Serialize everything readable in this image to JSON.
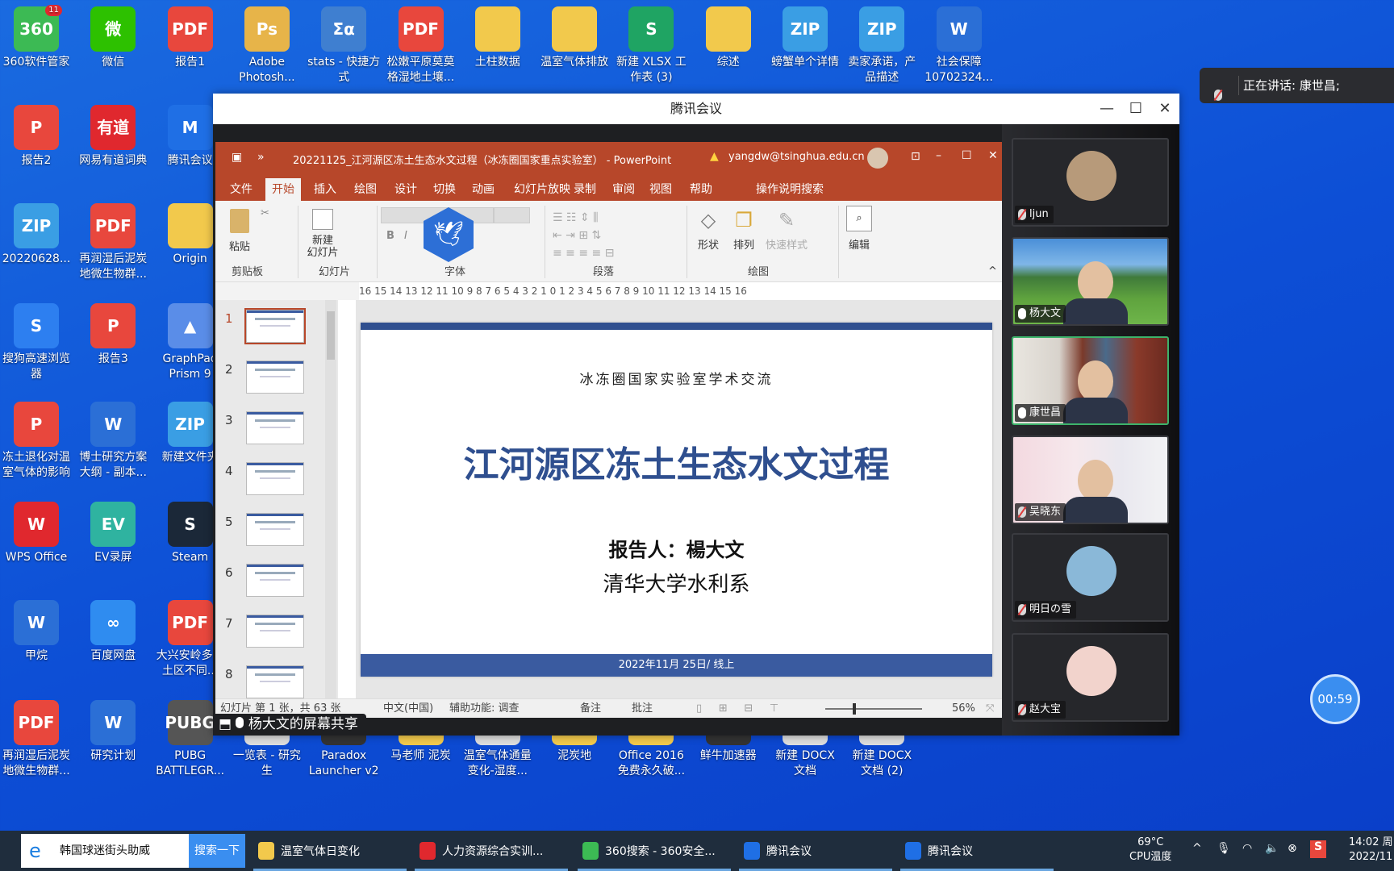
{
  "desktop_icons": [
    {
      "label": "360软件管家",
      "glyph": "360",
      "color": "#3cba54",
      "badge": "11"
    },
    {
      "label": "微信",
      "glyph": "微",
      "color": "#2dc100"
    },
    {
      "label": "报告1",
      "glyph": "PDF",
      "color": "#e8473d"
    },
    {
      "label": "Adobe Photosh...",
      "glyph": "Ps",
      "color": "#e7b449"
    },
    {
      "label": "stats - 快捷方式",
      "glyph": "Σα",
      "color": "#3f7fd0"
    },
    {
      "label": "松嫩平原莫莫格湿地土壤...",
      "glyph": "PDF",
      "color": "#e8473d"
    },
    {
      "label": "土柱数据",
      "glyph": "",
      "color": "#f2c94c"
    },
    {
      "label": "温室气体排放",
      "glyph": "",
      "color": "#f2c94c"
    },
    {
      "label": "新建 XLSX 工作表 (3)",
      "glyph": "S",
      "color": "#1fa463"
    },
    {
      "label": "综述",
      "glyph": "",
      "color": "#f2c94c"
    },
    {
      "label": "螃蟹单个详情",
      "glyph": "ZIP",
      "color": "#3a9ee4"
    },
    {
      "label": "卖家承诺，产品描述",
      "glyph": "ZIP",
      "color": "#3a9ee4"
    },
    {
      "label": "社会保障10702324...",
      "glyph": "W",
      "color": "#2b6fd6"
    },
    {
      "label": "报告2",
      "glyph": "P",
      "color": "#e8473d"
    },
    {
      "label": "网易有道词典",
      "glyph": "有道",
      "color": "#e0282e"
    },
    {
      "label": "腾讯会议",
      "glyph": "M",
      "color": "#1f6fe5"
    },
    {
      "label": "20220628...",
      "glyph": "ZIP",
      "color": "#3a9ee4"
    },
    {
      "label": "再润湿后泥炭地微生物群...",
      "glyph": "PDF",
      "color": "#e8473d"
    },
    {
      "label": "Origin",
      "glyph": "",
      "color": "#f2c94c"
    },
    {
      "label": "搜狗高速浏览器",
      "glyph": "S",
      "color": "#2d7ff0"
    },
    {
      "label": "报告3",
      "glyph": "P",
      "color": "#e8473d"
    },
    {
      "label": "GraphPad Prism 9",
      "glyph": "▲",
      "color": "#5a8de8"
    },
    {
      "label": "冻土退化对温室气体的影响",
      "glyph": "P",
      "color": "#e8473d"
    },
    {
      "label": "博士研究方案大纲 - 副本...",
      "glyph": "W",
      "color": "#2b6fd6"
    },
    {
      "label": "新建文件夹",
      "glyph": "ZIP",
      "color": "#3a9ee4"
    },
    {
      "label": "WPS Office",
      "glyph": "W",
      "color": "#e0282e"
    },
    {
      "label": "EV录屏",
      "glyph": "EV",
      "color": "#2fb3a0"
    },
    {
      "label": "Steam",
      "glyph": "S",
      "color": "#1b2838"
    },
    {
      "label": "甲烷",
      "glyph": "W",
      "color": "#2b6fd6"
    },
    {
      "label": "百度网盘",
      "glyph": "∞",
      "color": "#2f8cf0"
    },
    {
      "label": "大兴安岭多冻土区不同...",
      "glyph": "PDF",
      "color": "#e8473d"
    },
    {
      "label": "再润湿后泥炭地微生物群...",
      "glyph": "PDF",
      "color": "#e8473d"
    },
    {
      "label": "研究计划",
      "glyph": "W",
      "color": "#2b6fd6"
    },
    {
      "label": "PUBG BATTLEGR...",
      "glyph": "PUBG",
      "color": "#555"
    },
    {
      "label": "一览表 - 研究生",
      "glyph": "",
      "color": "#ddd"
    },
    {
      "label": "Paradox Launcher v2",
      "glyph": "",
      "color": "#333"
    },
    {
      "label": "马老师 泥炭",
      "glyph": "",
      "color": "#f2c94c"
    },
    {
      "label": "温室气体通量变化-湿度...",
      "glyph": "",
      "color": "#ddd"
    },
    {
      "label": "泥炭地",
      "glyph": "",
      "color": "#f2c94c"
    },
    {
      "label": "Office 2016 免费永久破...",
      "glyph": "",
      "color": "#f2c94c"
    },
    {
      "label": "鲜牛加速器",
      "glyph": "",
      "color": "#333"
    },
    {
      "label": "新建 DOCX 文档",
      "glyph": "",
      "color": "#ddd"
    },
    {
      "label": "新建 DOCX 文档 (2)",
      "glyph": "",
      "color": "#ddd"
    }
  ],
  "notification": {
    "text": "正在讲话: 康世昌;"
  },
  "meeting": {
    "title": "腾讯会议",
    "share_label": "杨大文的屏幕共享",
    "timer": "00:59",
    "participants": [
      {
        "name": "ljun",
        "muted": true,
        "speaking": false,
        "kind": "avatar",
        "avatar_color": "#b79a7a"
      },
      {
        "name": "杨大文",
        "muted": false,
        "speaking": false,
        "kind": "video",
        "bg": "linear-gradient(#4a8fd8 0%,#7fb6e8 30%,#3f7a3a 45%,#5fa33e 70%,#6eb54a 100%)"
      },
      {
        "name": "康世昌",
        "muted": false,
        "speaking": true,
        "kind": "video",
        "bg": "linear-gradient(90deg,#e9e6e0 0%,#d8d3cc 30%,#7b3a2a 45%,#4a6a8a 60%,#8a3a2a 80%,#6b2a20 100%)"
      },
      {
        "name": "吴晓东",
        "muted": true,
        "speaking": false,
        "kind": "video",
        "bg": "linear-gradient(90deg,#f3d9e0 0%,#f6e8ec 40%,#e9e8ef 70%,#f2f2f4 100%)"
      },
      {
        "name": "明日の雪",
        "muted": true,
        "speaking": false,
        "kind": "avatar",
        "avatar_color": "#8ab8d8"
      },
      {
        "name": "赵大宝",
        "muted": true,
        "speaking": false,
        "kind": "avatar",
        "avatar_color": "#f2d3cc"
      }
    ]
  },
  "ppt": {
    "title": "20221125_江河源区冻土生态水文过程（冰冻圈国家重点实验室） - PowerPoint",
    "account": "yangdw@tsinghua.edu.cn",
    "tabs": [
      "文件",
      "开始",
      "插入",
      "绘图",
      "设计",
      "切换",
      "动画",
      "幻灯片放映",
      "录制",
      "审阅",
      "视图",
      "帮助",
      "操作说明搜索"
    ],
    "active_tab": "开始",
    "ribbon": {
      "paste": "粘贴",
      "new_slide": "新建\n幻灯片",
      "shape": "形状",
      "arrange": "排列",
      "quick_style": "快速样式",
      "edit": "编辑",
      "groups": [
        "剪贴板",
        "幻灯片",
        "字体",
        "段落",
        "绘图"
      ]
    },
    "ruler": "16 15 14 13 12 11 10  9   8   7   6   5   4   3   2   1   0   1   2   3   4   5   6   7   8   9  10 11 12 13 14 15 16",
    "thumbnails": [
      "1",
      "2",
      "3",
      "4",
      "5",
      "6",
      "7",
      "8"
    ],
    "active_slide": 1,
    "slide": {
      "header": "冰冻圈国家实验室学术交流",
      "title": "江河源区冻土生态水文过程",
      "presenter": "报告人：楊大文",
      "affiliation": "清华大学水利系",
      "footer": "2022年11月 25日/ 线上"
    },
    "status": {
      "slide_count": "幻灯片 第 1 张，共 63 张",
      "language": "中文(中国)",
      "accessibility": "辅助功能: 调查",
      "notes": "备注",
      "comments": "批注",
      "zoom": "56%",
      "zoom_level": 0.56
    }
  },
  "taskbar": {
    "search_value": "韩国球迷街头助威",
    "search_button": "搜索一下",
    "items": [
      {
        "label": "温室气体日变化",
        "icon": "folder-icon",
        "color": "#f2c94c"
      },
      {
        "label": "人力资源综合实训...",
        "icon": "wps-icon",
        "color": "#e0282e"
      },
      {
        "label": "360搜索 - 360安全...",
        "icon": "browser-360-icon",
        "color": "#3cba54"
      },
      {
        "label": "腾讯会议",
        "icon": "tencent-meeting-icon",
        "color": "#1f6fe5"
      },
      {
        "label": "腾讯会议",
        "icon": "tencent-meeting-icon",
        "color": "#1f6fe5"
      }
    ],
    "cpu_temp": "69°C",
    "cpu_label": "CPU温度",
    "time": "14:02 周",
    "date": "2022/11"
  }
}
